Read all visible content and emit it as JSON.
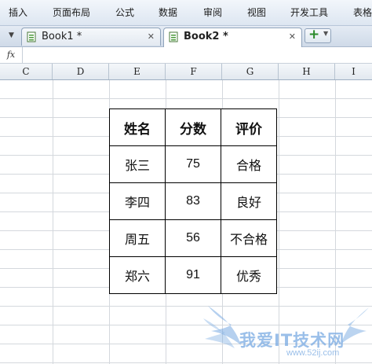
{
  "menu": {
    "items": [
      "插入",
      "页面布局",
      "公式",
      "数据",
      "审阅",
      "视图",
      "开发工具",
      "表格"
    ]
  },
  "tabs": [
    {
      "label": "Book1 *",
      "active": false
    },
    {
      "label": "Book2 *",
      "active": true
    }
  ],
  "formula_bar": {
    "fx_label": "fx",
    "value": ""
  },
  "columns": [
    "C",
    "D",
    "E",
    "F",
    "G",
    "H",
    "I"
  ],
  "table": {
    "headers": [
      "姓名",
      "分数",
      "评价"
    ],
    "rows": [
      [
        "张三",
        "75",
        "合格"
      ],
      [
        "李四",
        "83",
        "良好"
      ],
      [
        "周五",
        "56",
        "不合格"
      ],
      [
        "郑六",
        "91",
        "优秀"
      ]
    ]
  },
  "watermark": {
    "text": "我爱IT技术网",
    "url": "www.52ij.com"
  },
  "colors": {
    "ribbon": "#dde6f1",
    "grid_line": "#d4d8dd",
    "watermark": "#78aae1",
    "new_tab_plus": "#2a8a2a"
  },
  "icons": {
    "tab_document": "document-icon",
    "tab_close": "close-icon",
    "new_tab": "plus-icon",
    "new_tab_menu": "chevron-down-icon",
    "tab_list": "chevron-down-icon"
  }
}
